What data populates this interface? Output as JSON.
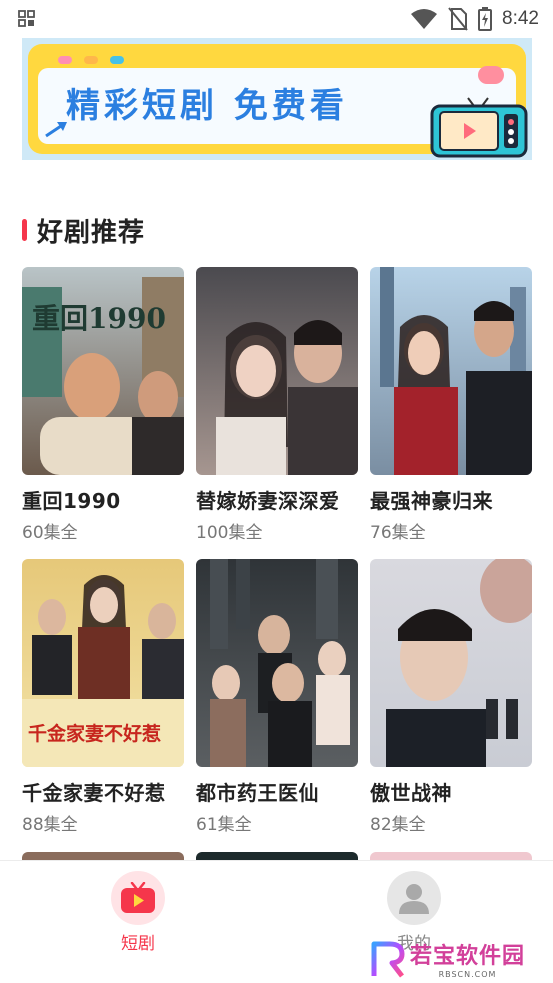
{
  "status_bar": {
    "time": "8:42",
    "icons": [
      "app-grid-icon",
      "wifi-icon",
      "no-sim-icon",
      "battery-charging-icon"
    ]
  },
  "banner": {
    "text": "精彩短剧 免费看"
  },
  "section": {
    "title": "好剧推荐"
  },
  "dramas": [
    {
      "title": "重回1990",
      "count": "60集全",
      "poster_text": "重回1990"
    },
    {
      "title": "替嫁娇妻深深爱",
      "count": "100集全",
      "poster_text": ""
    },
    {
      "title": "最强神豪归来",
      "count": "76集全",
      "poster_text": ""
    },
    {
      "title": "千金家妻不好惹",
      "count": "88集全",
      "poster_text": "千金家妻不好惹"
    },
    {
      "title": "都市药王医仙",
      "count": "61集全",
      "poster_text": ""
    },
    {
      "title": "傲世战神",
      "count": "82集全",
      "poster_text": ""
    }
  ],
  "tabbar": {
    "tabs": [
      {
        "label": "短剧",
        "icon": "tv-play-icon",
        "active": true
      },
      {
        "label": "我的",
        "icon": "profile-icon",
        "active": false
      }
    ]
  },
  "watermark": {
    "text": "若宝软件园",
    "sub": "RBSCN.COM"
  },
  "colors": {
    "accent": "#f5364b",
    "banner_yellow": "#ffd83f",
    "banner_text": "#2b7fe0"
  }
}
